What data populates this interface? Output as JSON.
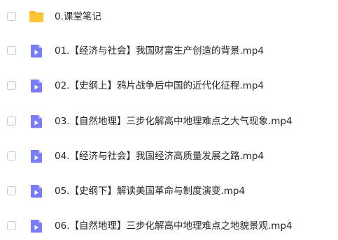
{
  "items": [
    {
      "type": "folder",
      "name": "0.课堂笔记"
    },
    {
      "type": "video",
      "name": "01.【经济与社会】我国财富生产创造的背景.mp4"
    },
    {
      "type": "video",
      "name": "02.【史纲上】鸦片战争后中国的近代化征程.mp4"
    },
    {
      "type": "video",
      "name": "03.【自然地理】三步化解高中地理难点之大气现象.mp4"
    },
    {
      "type": "video",
      "name": "04.【经济与社会】我国经济高质量发展之路.mp4"
    },
    {
      "type": "video",
      "name": "05.【史纲下】解读美国革命与制度演变.mp4"
    },
    {
      "type": "video",
      "name": "06.【自然地理】三步化解高中地理难点之地貌景观.mp4"
    }
  ],
  "colors": {
    "folder_icon": "#fcc636",
    "video_icon": "#7b7cf7",
    "text": "#1f2329",
    "checkbox_border": "#c9cdd4"
  }
}
